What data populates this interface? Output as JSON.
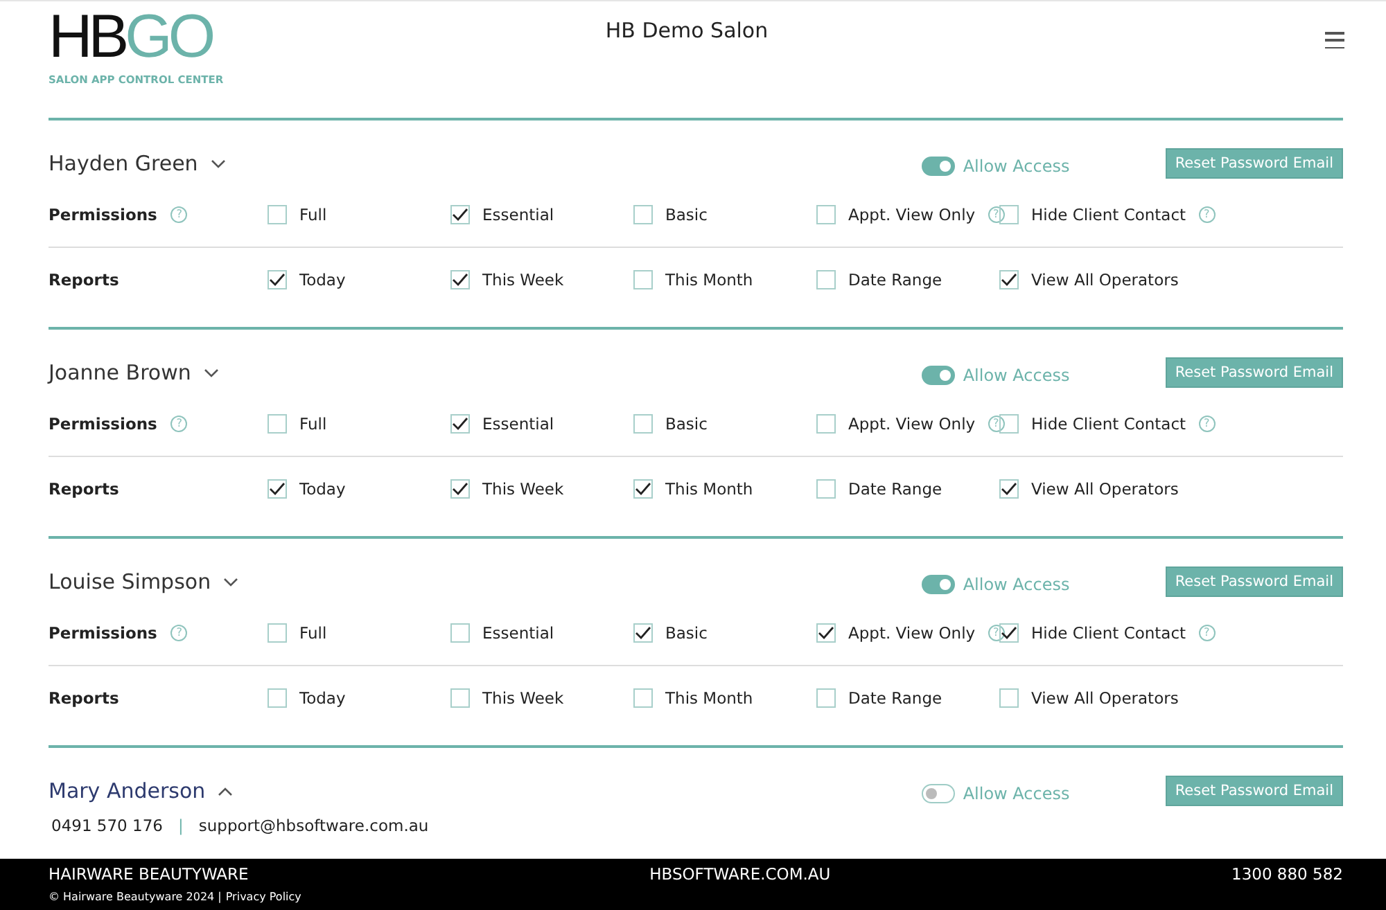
{
  "header": {
    "logo_text": "HBGO",
    "logo_tagline": "SALON APP CONTROL CENTER",
    "title": "HB Demo Salon"
  },
  "users": [
    {
      "name": "Hayden Green",
      "expanded": false,
      "allow_access": true,
      "allow_label": "Allow Access",
      "reset_button": "Reset Password Email",
      "groups": [
        {
          "label": "Permissions",
          "help": "?",
          "options": [
            {
              "label": "Full",
              "checked": false
            },
            {
              "label": "Essential",
              "checked": true
            },
            {
              "label": "Basic",
              "checked": false
            },
            {
              "label": "Appt. View Only",
              "checked": false,
              "help": "?"
            },
            {
              "label": "Hide Client Contact",
              "checked": false,
              "help": "?"
            }
          ]
        },
        {
          "label": "Reports",
          "options": [
            {
              "label": "Today",
              "checked": true
            },
            {
              "label": "This Week",
              "checked": true
            },
            {
              "label": "This Month",
              "checked": false
            },
            {
              "label": "Date Range",
              "checked": false
            },
            {
              "label": "View All Operators",
              "checked": true
            }
          ]
        }
      ]
    },
    {
      "name": "Joanne Brown",
      "expanded": false,
      "allow_access": true,
      "allow_label": "Allow Access",
      "reset_button": "Reset Password Email",
      "groups": [
        {
          "label": "Permissions",
          "help": "?",
          "options": [
            {
              "label": "Full",
              "checked": false
            },
            {
              "label": "Essential",
              "checked": true
            },
            {
              "label": "Basic",
              "checked": false
            },
            {
              "label": "Appt. View Only",
              "checked": false,
              "help": "?"
            },
            {
              "label": "Hide Client Contact",
              "checked": false,
              "help": "?"
            }
          ]
        },
        {
          "label": "Reports",
          "options": [
            {
              "label": "Today",
              "checked": true
            },
            {
              "label": "This Week",
              "checked": true
            },
            {
              "label": "This Month",
              "checked": true
            },
            {
              "label": "Date Range",
              "checked": false
            },
            {
              "label": "View All Operators",
              "checked": true
            }
          ]
        }
      ]
    },
    {
      "name": "Louise Simpson",
      "expanded": false,
      "allow_access": true,
      "allow_label": "Allow Access",
      "reset_button": "Reset Password Email",
      "groups": [
        {
          "label": "Permissions",
          "help": "?",
          "options": [
            {
              "label": "Full",
              "checked": false
            },
            {
              "label": "Essential",
              "checked": false
            },
            {
              "label": "Basic",
              "checked": true
            },
            {
              "label": "Appt. View Only",
              "checked": true,
              "help": "?"
            },
            {
              "label": "Hide Client Contact",
              "checked": true,
              "help": "?"
            }
          ]
        },
        {
          "label": "Reports",
          "options": [
            {
              "label": "Today",
              "checked": false
            },
            {
              "label": "This Week",
              "checked": false
            },
            {
              "label": "This Month",
              "checked": false
            },
            {
              "label": "Date Range",
              "checked": false
            },
            {
              "label": "View All Operators",
              "checked": false
            }
          ]
        }
      ]
    },
    {
      "name": "Mary Anderson",
      "expanded": true,
      "allow_access": false,
      "allow_label": "Allow Access",
      "reset_button": "Reset Password Email",
      "contact": {
        "phone": "0491 570 176",
        "separator": "|",
        "email": "support@hbsoftware.com.au"
      }
    }
  ],
  "footer": {
    "brand": "HAIRWARE BEAUTYWARE",
    "website": "HBSOFTWARE.COM.AU",
    "phone": "1300 880 582",
    "copyright": "© Hairware Beautyware 2024 |",
    "privacy_link": "Privacy Policy"
  }
}
